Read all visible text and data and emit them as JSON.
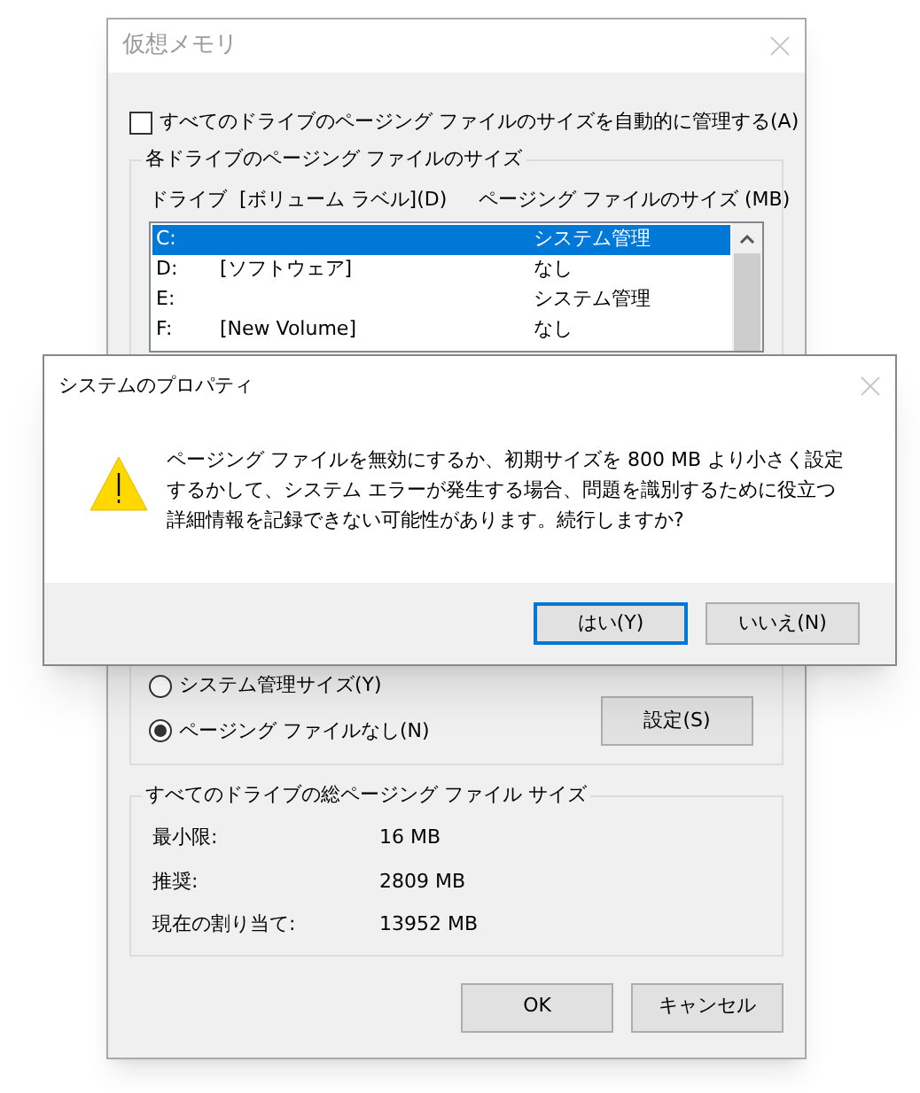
{
  "window": {
    "title": "仮想メモリ",
    "active": false
  },
  "auto_manage": {
    "label": "すべてのドライブのページング ファイルのサイズを自動的に管理する(A)",
    "checked": false
  },
  "drive_group": {
    "title": "各ドライブのページング ファイルのサイズ",
    "columns": [
      "ドライブ  [ボリューム ラベル](D)",
      "ページング ファイルのサイズ (MB)"
    ],
    "drives": [
      {
        "drive": "C:",
        "size": "システム管理",
        "selected": true
      },
      {
        "drive": "D:",
        "label": "[ソフトウェア]",
        "size": "なし",
        "selected": false
      },
      {
        "drive": "E:",
        "size": "システム管理",
        "selected": false
      },
      {
        "drive": "F:",
        "label": "[New Volume]",
        "size": "なし",
        "selected": false
      }
    ]
  },
  "size_options": [
    {
      "label": "システム管理サイズ(Y)",
      "selected": false
    },
    {
      "label": "ページング ファイルなし(N)",
      "selected": true
    }
  ],
  "set_button": "設定(S)",
  "totals": {
    "title": "すべてのドライブの総ページング ファイル サイズ",
    "rows": [
      {
        "label": "最小限:",
        "value": "16 MB"
      },
      {
        "label": "推奨:",
        "value": "2809 MB"
      },
      {
        "label": "現在の割り当て:",
        "value": "13952 MB"
      }
    ]
  },
  "buttons": [
    "OK",
    "キャンセル"
  ],
  "alert": {
    "title": "システムのプロパティ",
    "message": "ページング ファイルを無効にするか、初期サイズを 800 MB より小さく設定するかして、システム エラーが発生する場合、問題を識別するために役立つ詳細情報を記録できない可能性があります。続行しますか?",
    "buttons": [
      {
        "label": "はい(Y)",
        "default": true
      },
      {
        "label": "いいえ(N)",
        "default": false
      }
    ]
  }
}
